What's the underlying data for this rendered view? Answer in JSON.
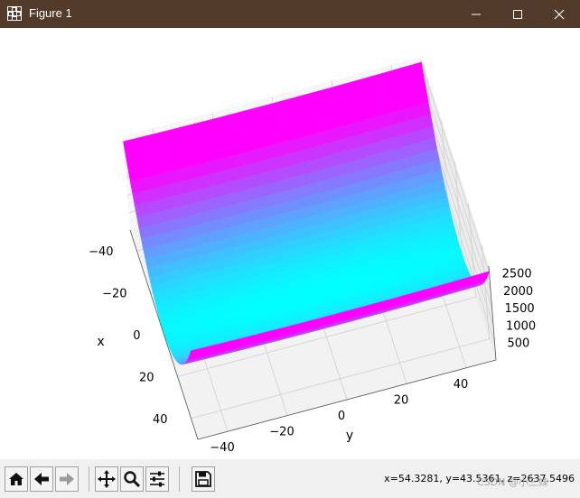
{
  "window": {
    "title": "Figure 1",
    "controls": [
      "minimize",
      "maximize",
      "close"
    ]
  },
  "chart_data": {
    "type": "surface3d",
    "colormap": "cool",
    "xlabel": "x",
    "ylabel": "y",
    "zlabel": "",
    "x_ticks": [
      "−40",
      "−20",
      "0",
      "20",
      "40"
    ],
    "y_ticks": [
      "−40",
      "−20",
      "0",
      "20",
      "40"
    ],
    "z_ticks": [
      "500",
      "1000",
      "1500",
      "2000",
      "2500"
    ],
    "xlim": [
      -50,
      50
    ],
    "ylim": [
      -50,
      50
    ],
    "zlim": [
      0,
      2700
    ],
    "grid": true
  },
  "toolbar": {
    "buttons": [
      "home-icon",
      "back-icon",
      "forward-icon",
      "pan-icon",
      "zoom-icon",
      "configure-subplots-icon",
      "save-icon"
    ],
    "coords": "x=54.3281, y=43.5361, z=2637.5496"
  },
  "watermark": "CSDN @小三妹"
}
